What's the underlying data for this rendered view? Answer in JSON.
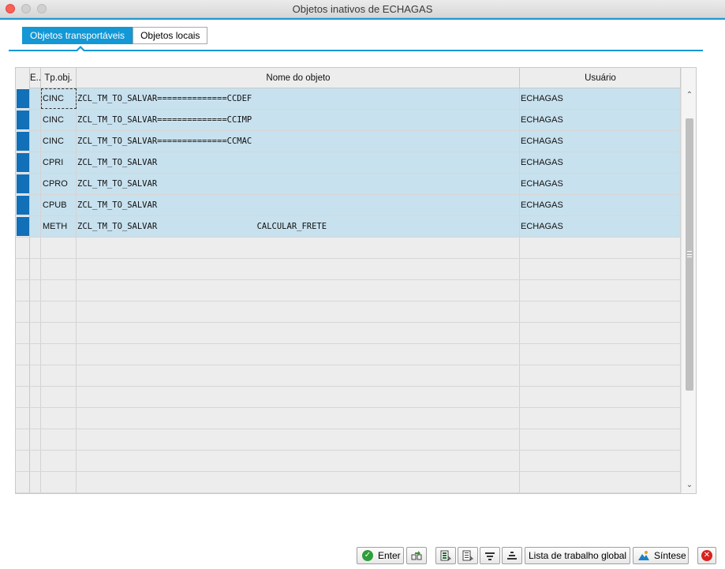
{
  "window": {
    "title": "Objetos inativos de ECHAGAS"
  },
  "tabs": [
    {
      "label": "Objetos transportáveis",
      "active": true
    },
    {
      "label": "Objetos locais",
      "active": false
    }
  ],
  "table": {
    "columns": {
      "e": "E..",
      "tp": "Tp.obj.",
      "name": "Nome do objeto",
      "user": "Usuário"
    },
    "rows": [
      {
        "tp": "CINC",
        "name": "ZCL_TM_TO_SALVAR==============CCDEF",
        "user": "ECHAGAS"
      },
      {
        "tp": "CINC",
        "name": "ZCL_TM_TO_SALVAR==============CCIMP",
        "user": "ECHAGAS"
      },
      {
        "tp": "CINC",
        "name": "ZCL_TM_TO_SALVAR==============CCMAC",
        "user": "ECHAGAS"
      },
      {
        "tp": "CPRI",
        "name": "ZCL_TM_TO_SALVAR",
        "user": "ECHAGAS"
      },
      {
        "tp": "CPRO",
        "name": "ZCL_TM_TO_SALVAR",
        "user": "ECHAGAS"
      },
      {
        "tp": "CPUB",
        "name": "ZCL_TM_TO_SALVAR",
        "user": "ECHAGAS"
      },
      {
        "tp": "METH",
        "name": "ZCL_TM_TO_SALVAR                    CALCULAR_FRETE",
        "user": "ECHAGAS"
      }
    ],
    "empty_rows": 12
  },
  "toolbar": {
    "enter_label": "Enter",
    "global_worklist_label": "Lista de trabalho global",
    "synthesis_label": "Síntese",
    "icons": {
      "enter": "check-icon",
      "transport": "transport-icon",
      "select_all": "select-all-icon",
      "deselect_all": "deselect-all-icon",
      "filter": "filter-icon",
      "sort": "sort-icon",
      "synthesis": "mountain-chart-icon",
      "cancel": "cancel-icon"
    }
  },
  "colors": {
    "accent": "#1397d5",
    "row_selected": "#c8e1ee",
    "row_marker": "#1170b8",
    "enter_icon": "#2e9e3a",
    "cancel_icon": "#d9221c"
  }
}
